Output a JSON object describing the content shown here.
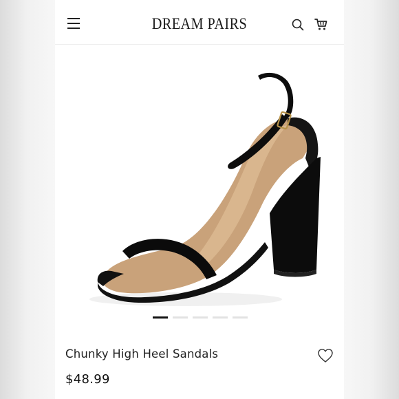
{
  "header": {
    "brand": "DREAM PAIRS",
    "menu_icon": "hamburger-menu-icon",
    "search_icon": "search-icon",
    "cart_icon": "shopping-cart-icon"
  },
  "gallery": {
    "image_count": 5,
    "active_index": 0
  },
  "product": {
    "name": "Chunky High Heel Sandals",
    "price": "$48.99",
    "wishlist_icon": "heart-outline-icon",
    "color": "#000000"
  },
  "colors": {
    "background": "#ffffff",
    "text": "#222222",
    "dot_active": "#111111",
    "dot_inactive": "#e2e2e2"
  }
}
